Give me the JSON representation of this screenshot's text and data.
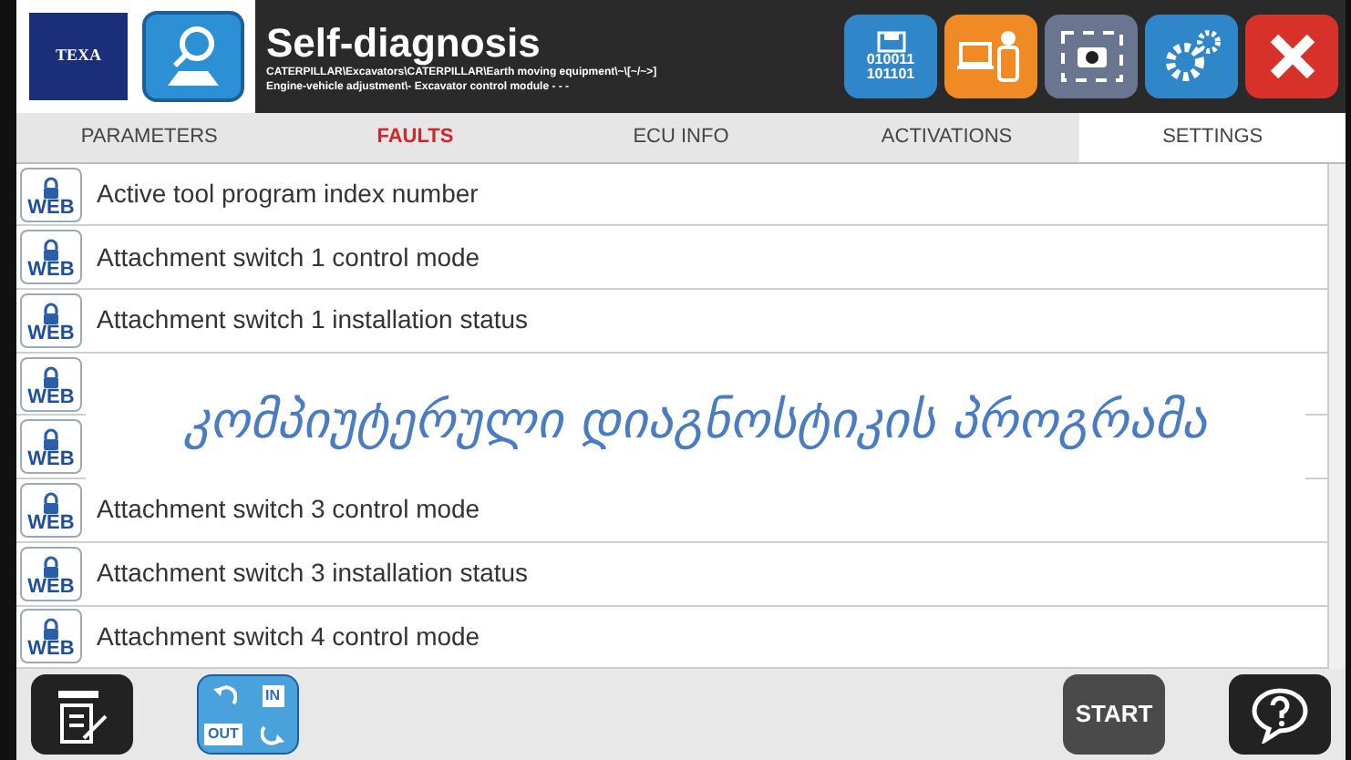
{
  "header": {
    "logo": "TEXA",
    "title": "Self-diagnosis",
    "path_line_1": "CATERPILLAR\\Excavators\\CATERPILLAR\\Earth moving equipment\\~\\[~/~>]",
    "path_line_2": "Engine-vehicle adjustment\\- Excavator control module - - -",
    "data_icon_text": [
      "010011",
      "101101"
    ]
  },
  "tabs": [
    {
      "label": "PARAMETERS",
      "selected": false,
      "highlight": false
    },
    {
      "label": "FAULTS",
      "selected": false,
      "highlight": true
    },
    {
      "label": "ECU INFO",
      "selected": false,
      "highlight": false
    },
    {
      "label": "ACTIVATIONS",
      "selected": false,
      "highlight": false
    },
    {
      "label": "SETTINGS",
      "selected": true,
      "highlight": false
    }
  ],
  "rows": [
    {
      "badge": "WEB",
      "label": "Active tool program index number"
    },
    {
      "badge": "WEB",
      "label": "Attachment switch 1 control mode"
    },
    {
      "badge": "WEB",
      "label": "Attachment switch 1 installation status"
    },
    {
      "badge": "WEB"
    },
    {
      "badge": "WEB"
    },
    {
      "badge": "WEB",
      "label": "Attachment switch 3 control mode"
    },
    {
      "badge": "WEB",
      "label": "Attachment switch 3 installation status"
    },
    {
      "badge": "WEB",
      "label": "Attachment switch 4 control mode"
    }
  ],
  "caption": "კომპიუტერული დიაგნოსტიკის პროგრამა",
  "toolbar": {
    "in_label": "IN",
    "out_label": "OUT",
    "start": "START"
  }
}
